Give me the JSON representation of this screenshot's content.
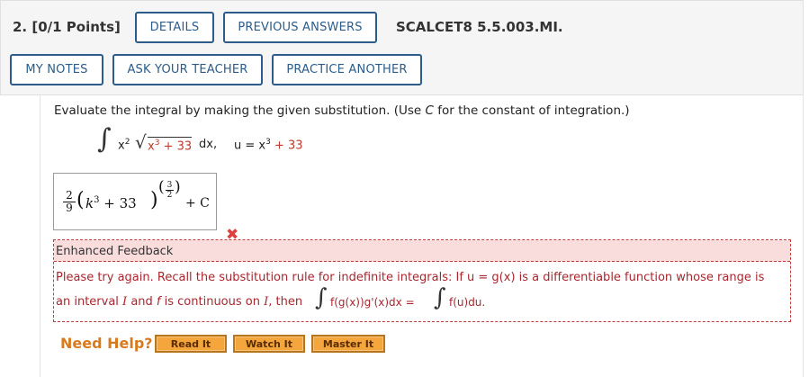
{
  "header": {
    "question_number": "2.",
    "points": "[0/1 Points]",
    "details_button": "DETAILS",
    "previous_answers_button": "PREVIOUS ANSWERS",
    "question_code": "SCALCET8 5.5.003.MI.",
    "my_notes_button": "MY NOTES",
    "ask_teacher_button": "ASK YOUR TEACHER",
    "practice_button": "PRACTICE ANOTHER"
  },
  "question": {
    "prompt_pre": "Evaluate the integral by making the given substitution. (Use ",
    "prompt_var": "C",
    "prompt_post": " for the constant of integration.)",
    "integrand_x": "x",
    "integrand_x_exp": "2",
    "radicand": "x",
    "radicand_exp": "3",
    "radicand_rest": " + 33",
    "dx": " dx,",
    "substitution_lhs": "u = x",
    "substitution_exp": "3",
    "substitution_rest": " + 33"
  },
  "answer": {
    "coef_num": "2",
    "coef_den": "9",
    "base_var": "k",
    "base_exp": "3",
    "base_rest": " + 33",
    "power_num": "3",
    "power_den": "2",
    "constant": "+ C",
    "status": "incorrect"
  },
  "feedback": {
    "title": "Enhanced Feedback",
    "line1": "Please try again. Recall the substitution rule for indefinite integrals: If  u = g(x)  is a differentiable function whose range is",
    "line2_pre": "an interval ",
    "line2_I": "I",
    "line2_mid1": " and ",
    "line2_f": "f",
    "line2_mid2": " is continuous on ",
    "line2_I2": "I",
    "line2_post": ", then",
    "formula_left": "f(g(x))g'(x)dx =",
    "formula_right": "f(u)du."
  },
  "help": {
    "label": "Need Help?",
    "read_button": "Read It",
    "watch_button": "Watch It",
    "master_button": "Master It"
  },
  "colors": {
    "button_border": "#2b5c8a",
    "feedback_red": "#c23b3b",
    "help_orange": "#d87a1e",
    "help_button": "#f4a53c"
  }
}
